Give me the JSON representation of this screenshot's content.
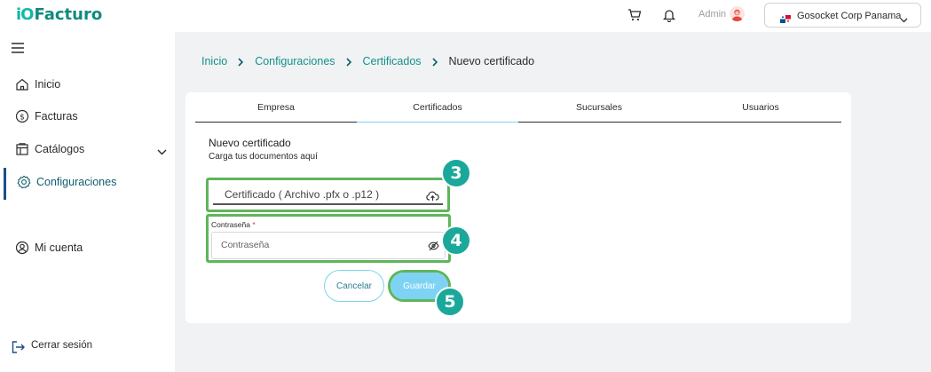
{
  "app": {
    "logo_mark": "iO",
    "logo_text": "Facturo"
  },
  "header": {
    "user_label": "Admin",
    "company_name": "Gosocket Corp Panama",
    "icons": [
      "cart-icon",
      "bell-icon",
      "avatar",
      "panama-flag-icon",
      "chevron-down-icon"
    ]
  },
  "sidebar": {
    "items": [
      {
        "label": "Inicio",
        "icon": "home-icon"
      },
      {
        "label": "Facturas",
        "icon": "dollar-circle-icon"
      },
      {
        "label": "Catálogos",
        "icon": "catalog-icon"
      },
      {
        "label": "Configuraciones",
        "icon": "gear-icon"
      },
      {
        "label": "Mi cuenta",
        "icon": "user-circle-icon"
      }
    ],
    "active_item": "Configuraciones",
    "logout_label": "Cerrar sesión"
  },
  "breadcrumb": {
    "items": [
      "Inicio",
      "Configuraciones",
      "Certificados",
      "Nuevo certificado"
    ]
  },
  "tabs": {
    "items": [
      "Empresa",
      "Certificados",
      "Sucursales",
      "Usuarios"
    ],
    "active": "Certificados"
  },
  "form": {
    "title": "Nuevo certificado",
    "subtitle": "Carga tus documentos aquí",
    "file_placeholder": "Certificado ( Archivo .pfx o .p12 )",
    "password_label": "Contraseña",
    "password_required_mark": "*",
    "password_placeholder": "Contraseña",
    "cancel_label": "Cancelar",
    "save_label": "Guardar"
  },
  "annotations": {
    "badge_3": "3",
    "badge_4": "4",
    "badge_5": "5"
  },
  "colors": {
    "accent_teal": "#11918a",
    "highlight_green": "#5fb55a",
    "badge_teal": "#1aa89a",
    "save_button": "#7ed3f5",
    "active_nav_bar": "#1d4e89"
  }
}
